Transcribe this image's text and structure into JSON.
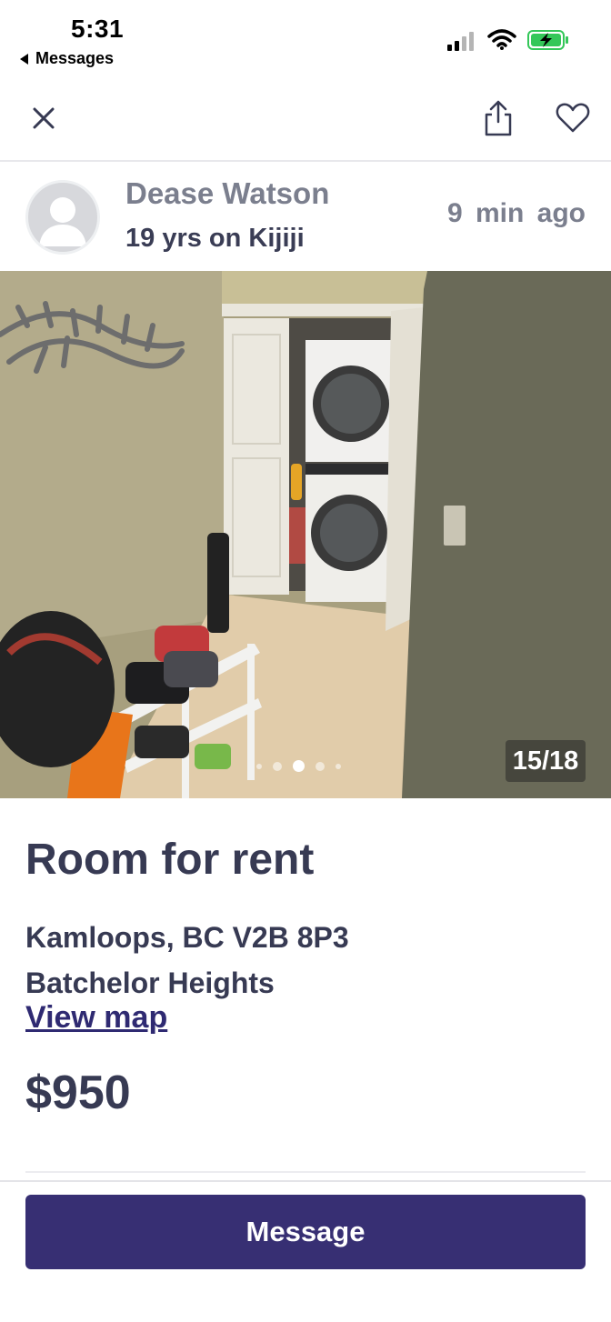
{
  "status_bar": {
    "time": "5:31",
    "back_app_label": "Messages",
    "icons": [
      "signal-icon",
      "wifi-icon",
      "battery-charging-icon"
    ],
    "battery_color": "#34c759"
  },
  "nav": {
    "icons": [
      "close-icon",
      "share-icon",
      "heart-icon"
    ]
  },
  "seller": {
    "name": "Dease Watson",
    "membership": "19 yrs on Kijiji",
    "posted": "9 min ago"
  },
  "gallery": {
    "counter": "15/18",
    "current_index": 15,
    "total": 18
  },
  "listing": {
    "title": "Room for rent",
    "address_line1": "Kamloops, BC V2B 8P3",
    "address_line2": "Batchelor Heights",
    "map_link": "View map",
    "price": "$950"
  },
  "actions": {
    "message_label": "Message"
  },
  "colors": {
    "primary": "#372f73",
    "text_dark": "#373a53",
    "text_muted": "#7b7f8e"
  }
}
